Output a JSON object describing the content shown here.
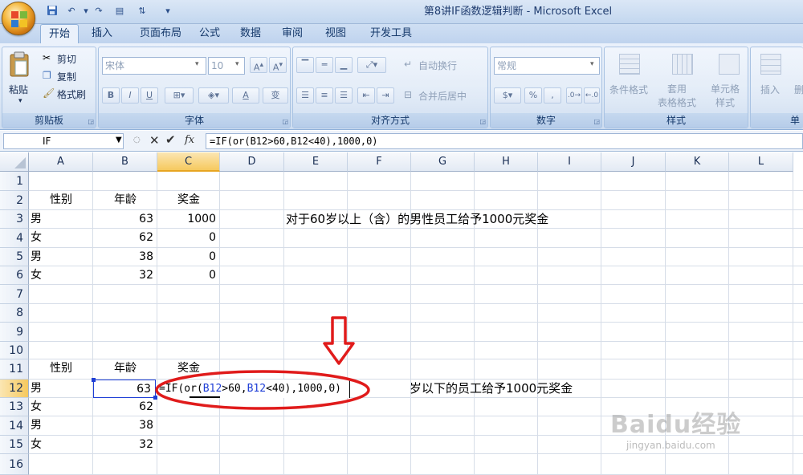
{
  "window": {
    "title": "第8讲IF函数逻辑判断 - Microsoft Excel"
  },
  "tabs": [
    "开始",
    "插入",
    "页面布局",
    "公式",
    "数据",
    "审阅",
    "视图",
    "开发工具"
  ],
  "ribbon": {
    "clipboard": {
      "label": "剪贴板",
      "paste": "粘贴",
      "cut": "剪切",
      "copy": "复制",
      "format_painter": "格式刷"
    },
    "font": {
      "label": "字体",
      "font_name": "宋体",
      "font_size": "10",
      "bold": "B",
      "italic": "I",
      "underline": "U",
      "font_color": "A",
      "phonetic": "变"
    },
    "alignment": {
      "label": "对齐方式",
      "wrap": "自动换行",
      "merge": "合并后居中"
    },
    "number": {
      "label": "数字",
      "format": "常规",
      "percent": "%",
      "comma": ","
    },
    "styles": {
      "label": "样式",
      "conditional": "条件格式",
      "table": "套用\n表格格式",
      "cell_styles": "单元格\n样式"
    },
    "cells": {
      "label": "单",
      "insert": "插入",
      "delete": "删"
    }
  },
  "formula_bar": {
    "name_box": "IF",
    "formula": "=IF(or(B12>60,B12<40),1000,0)",
    "fx": "fx"
  },
  "columns": [
    "A",
    "B",
    "C",
    "D",
    "E",
    "F",
    "G",
    "H",
    "I",
    "J",
    "K",
    "L"
  ],
  "rows": [
    "1",
    "2",
    "3",
    "4",
    "5",
    "6",
    "7",
    "8",
    "9",
    "10",
    "11",
    "12",
    "13",
    "14",
    "15",
    "16"
  ],
  "table1": {
    "headers": [
      "性别",
      "年龄",
      "奖金"
    ],
    "rows": [
      [
        "男",
        "63",
        "1000"
      ],
      [
        "女",
        "62",
        "0"
      ],
      [
        "男",
        "38",
        "0"
      ],
      [
        "女",
        "32",
        "0"
      ]
    ]
  },
  "note1": "对于60岁以上（含）的男性员工给予1000元奖金",
  "table2": {
    "headers": [
      "性别",
      "年龄",
      "奖金"
    ],
    "rows": [
      [
        "男",
        "63"
      ],
      [
        "女",
        "62"
      ],
      [
        "男",
        "38"
      ],
      [
        "女",
        "32"
      ]
    ]
  },
  "editing_cell": {
    "prefix": "=IF(or(",
    "ref1": "B12",
    "mid": ">60,",
    "ref2": "B12",
    "suffix": "<40),1000,0)"
  },
  "note2": "岁以下的员工给予1000元奖金",
  "watermark": {
    "brand": "Baidu经验",
    "url": "jingyan.baidu.com"
  },
  "colors": {
    "ref_blue": "#1f3fd6",
    "annotation_red": "#e01b1b",
    "selected_header": "#f6c95e"
  }
}
